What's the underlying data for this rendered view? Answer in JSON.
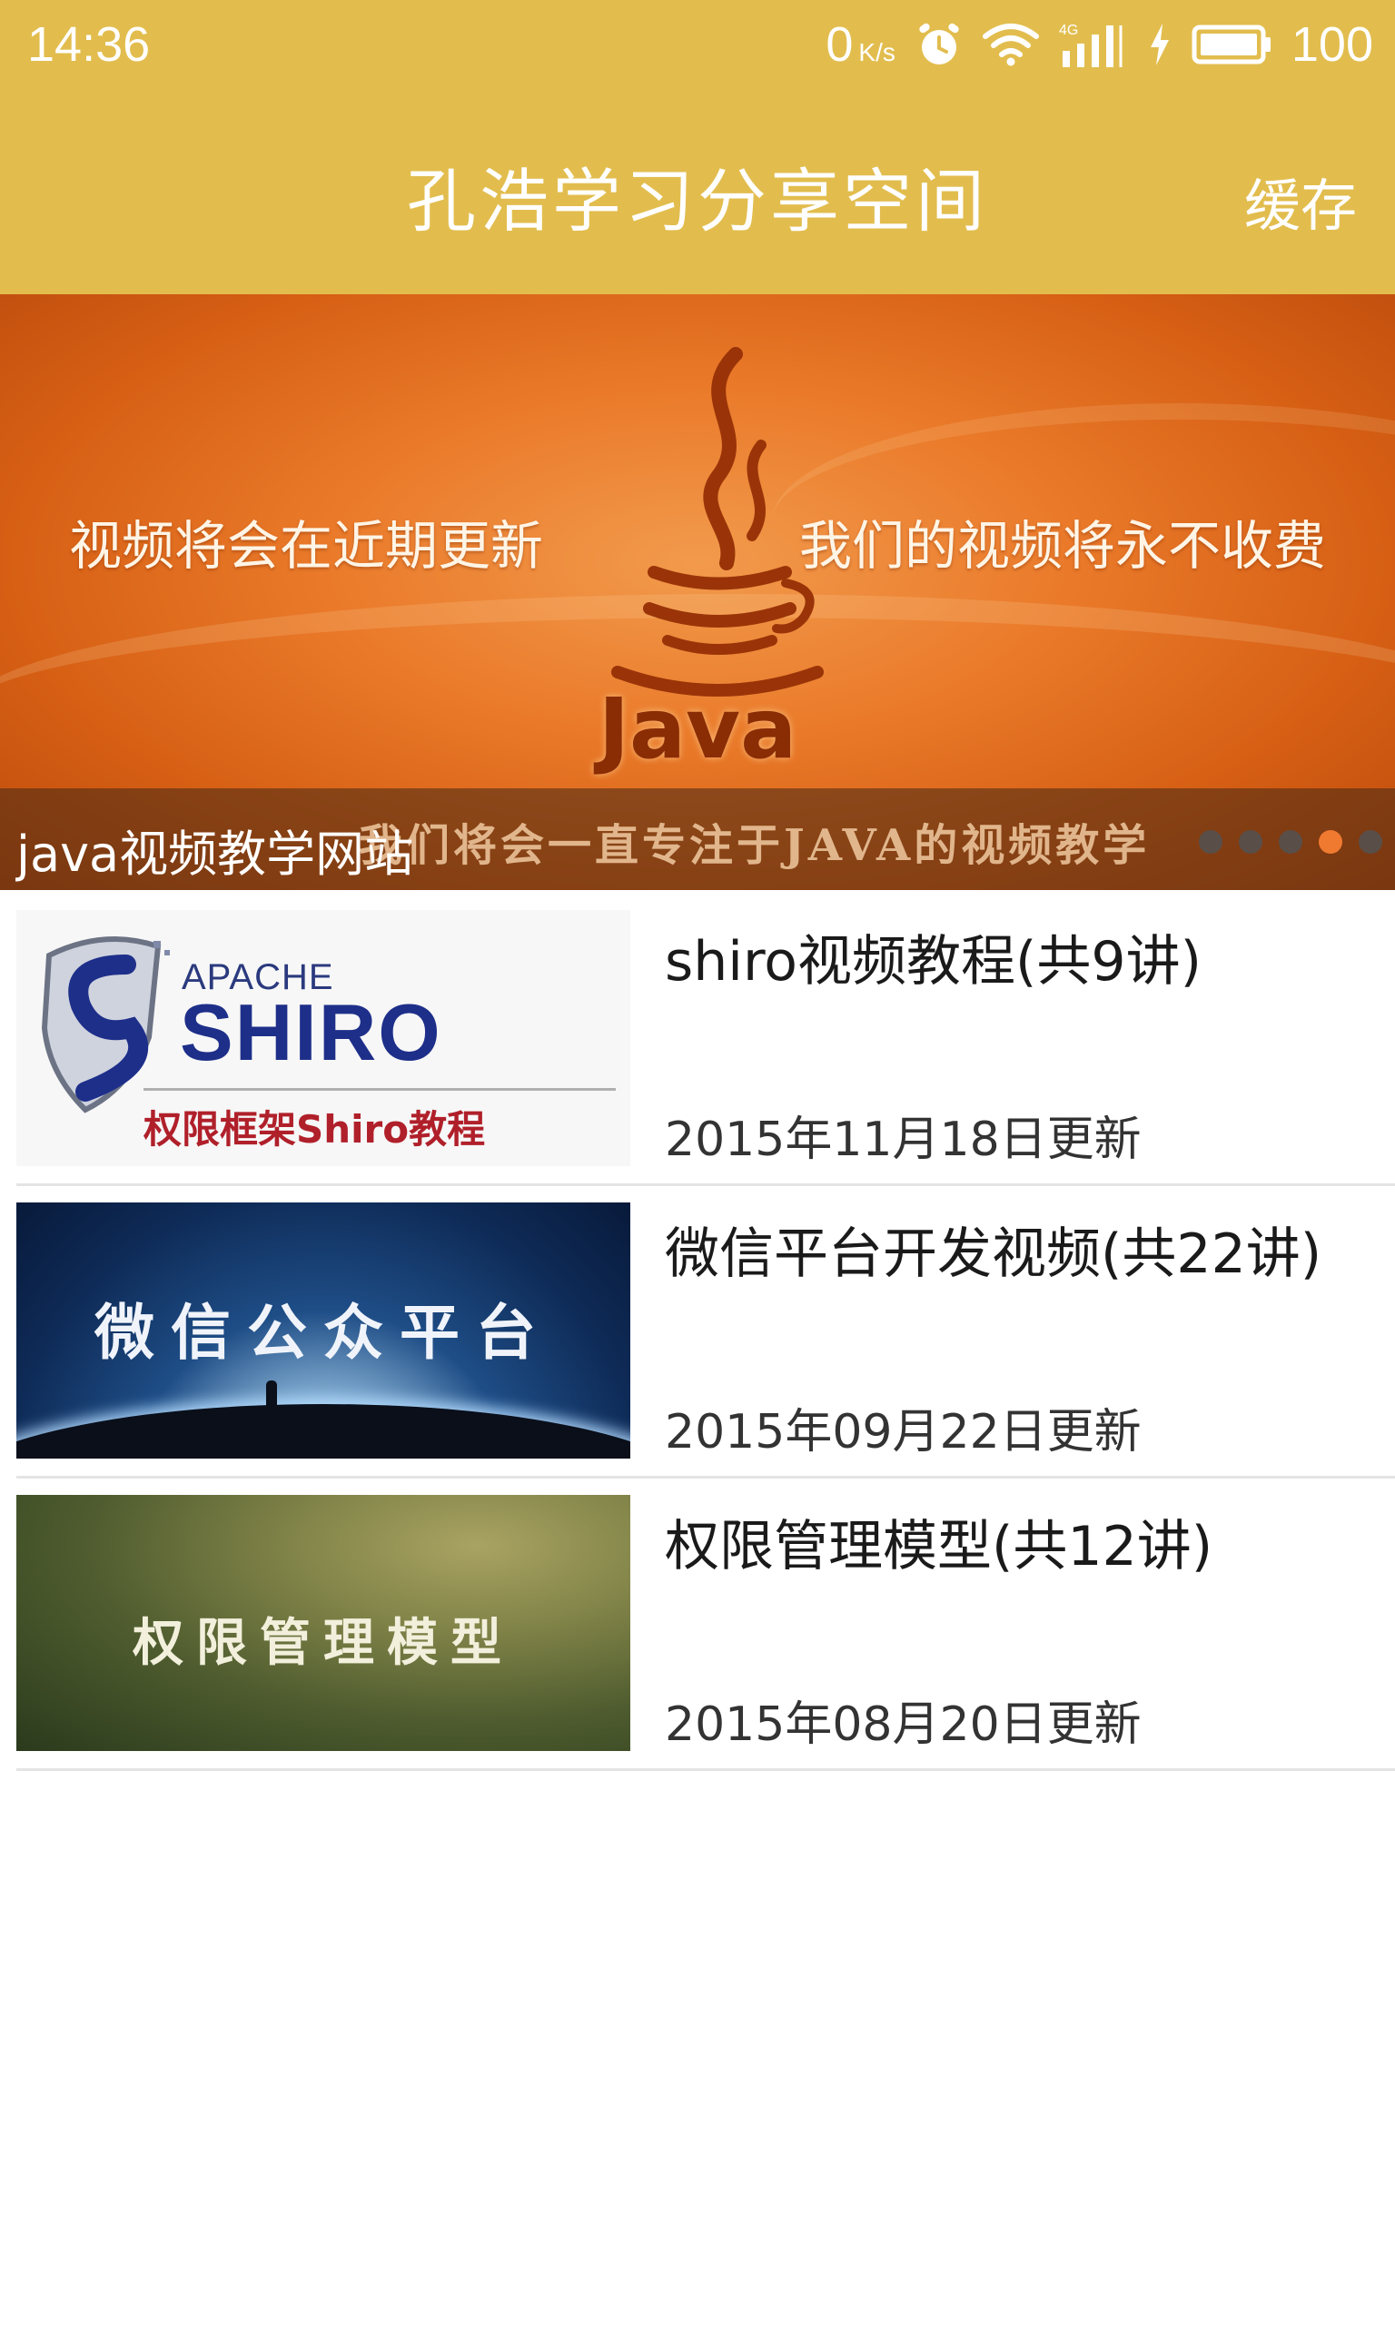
{
  "status_bar": {
    "time": "14:36",
    "net_speed": "0",
    "net_speed_unit": "K/s",
    "battery_level": "100",
    "icons": [
      "alarm-icon",
      "wifi-icon",
      "signal-4g-icon",
      "charging-icon",
      "battery-icon"
    ]
  },
  "app_bar": {
    "title": "孔浩学习分享空间",
    "cache_label": "缓存",
    "color": "#e2bd4e"
  },
  "banner": {
    "left_text": "视频将会在近期更新",
    "right_text": "我们的视频将永不收费",
    "logo_text": "Java",
    "slogan": "我们将会一直专注于JAVA的视频教学",
    "caption": "java视频教学网站",
    "page_count": 5,
    "active_page": 4
  },
  "courses": [
    {
      "title": "shiro视频教程(共9讲)",
      "date": "2015年11月18日更新",
      "thumb": {
        "apache": "APACHE",
        "name": "SHIRO",
        "subtitle": "权限框架Shiro教程"
      }
    },
    {
      "title": "微信平台开发视频(共22讲)",
      "date": "2015年09月22日更新",
      "thumb": {
        "text": "微信公众平台"
      }
    },
    {
      "title": "权限管理模型(共12讲)",
      "date": "2015年08月20日更新",
      "thumb": {
        "text": "权限管理模型"
      }
    }
  ]
}
